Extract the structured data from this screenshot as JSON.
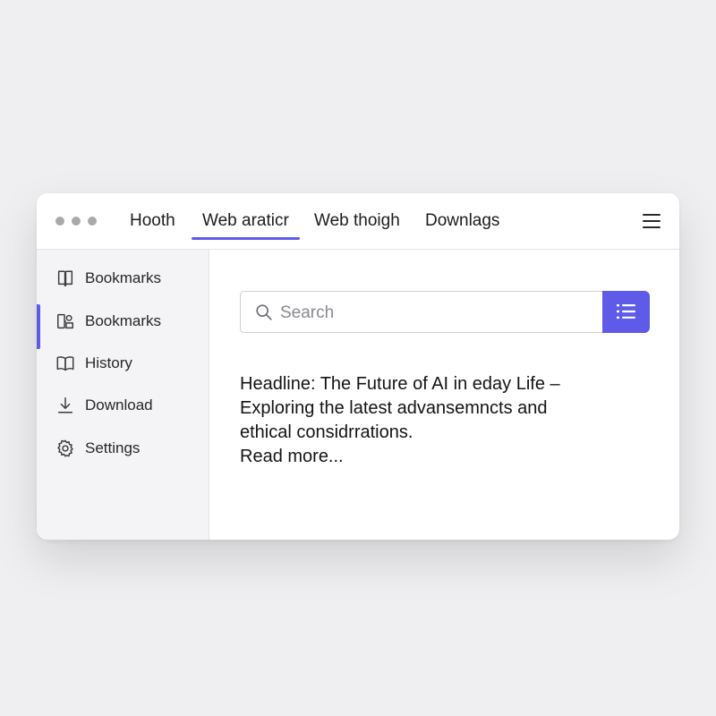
{
  "titlebar": {
    "tabs": [
      {
        "label": "Hooth",
        "active": false
      },
      {
        "label": "Web araticr",
        "active": true
      },
      {
        "label": "Web thoigh",
        "active": false
      },
      {
        "label": "Downlags",
        "active": false
      }
    ],
    "menu_icon": "hamburger-menu-icon"
  },
  "sidebar": {
    "items": [
      {
        "label": "Bookmarks",
        "icon": "book-icon",
        "selected": false
      },
      {
        "label": "Bookmarks",
        "icon": "bookmarks-shapes-icon",
        "selected": true
      },
      {
        "label": "History",
        "icon": "open-book-icon",
        "selected": false
      },
      {
        "label": "Download",
        "icon": "download-icon",
        "selected": false
      },
      {
        "label": "Settings",
        "icon": "gear-icon",
        "selected": false
      }
    ]
  },
  "search": {
    "placeholder": "Search",
    "value": "",
    "icon": "search-icon",
    "button_icon": "list-icon"
  },
  "article": {
    "headline": "Headline: The Future of AI in eday Life –",
    "line2": "Exploring the latest advansemncts and",
    "line3": "ethical considrrations.",
    "read_more": "Read more..."
  },
  "colors": {
    "accent": "#5d5be8",
    "background": "#efeff1",
    "sidebar": "#f4f4f6",
    "window": "#ffffff"
  }
}
